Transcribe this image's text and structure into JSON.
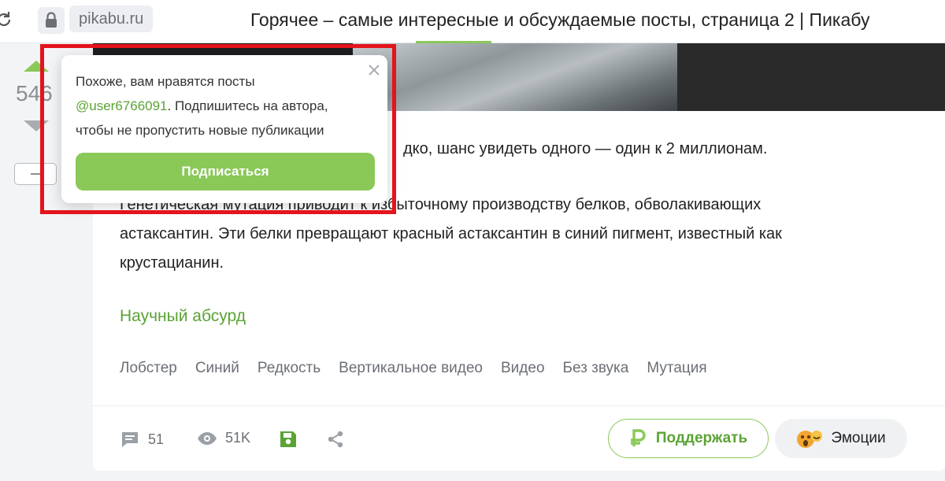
{
  "browser": {
    "url": "pikabu.ru",
    "title": "Горячее – самые интересные и обсуждаемые посты, страница 2 | Пикабу"
  },
  "vote": {
    "count": "546"
  },
  "popup": {
    "line1": "Похоже, вам нравятся посты",
    "user": "@user6766091",
    "line2_rest": ". Подпишитесь на автора,",
    "line3": "чтобы не пропустить новые публикации",
    "subscribe_label": "Подписаться"
  },
  "post": {
    "p1_visible": "дко, шанс увидеть одного — один к 2 миллионам.",
    "p2_line1": "Генетическая мутация приводит к избыточному производству белков, обволакивающих",
    "p2_line2": "астаксантин. Эти белки превращают красный астаксантин в синий пигмент, известный как",
    "p2_line3": "крустацианин.",
    "community": "Научный абсурд",
    "tags": [
      "Лобстер",
      "Синий",
      "Редкость",
      "Вертикальное видео",
      "Видео",
      "Без звука",
      "Мутация"
    ]
  },
  "footer": {
    "comments": "51",
    "views": "51K",
    "support_label": "Поддержать",
    "emotions_label": "Эмоции"
  },
  "colors": {
    "accent": "#8ac858",
    "link": "#5ba335",
    "highlight": "#e3141c"
  }
}
